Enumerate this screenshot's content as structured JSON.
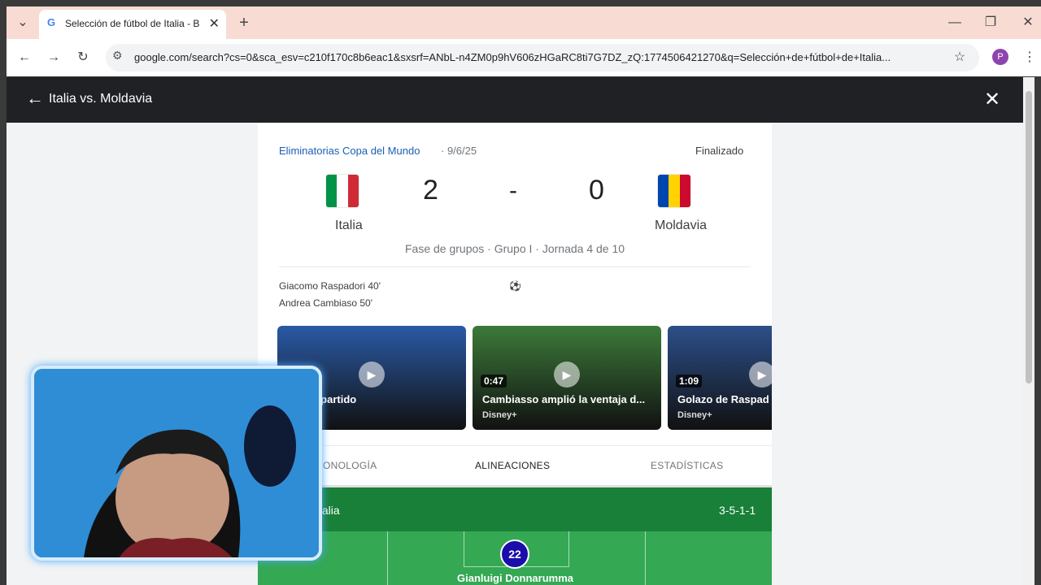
{
  "browser": {
    "tab_title": "Selección de fútbol de Italia - B",
    "favicon": "G",
    "tab_close": "✕",
    "new_tab": "+",
    "tab_menu": "⌄",
    "url": "google.com/search?cs=0&sca_esv=c210f170c8b6eac1&sxsrf=ANbL-n4ZM0p9hV606zHGaRC8ti7G7DZ_zQ:1774506421270&q=Selección+de+fútbol+de+Italia...",
    "profile_initial": "P",
    "window_minimize": "—",
    "window_restore": "❐",
    "window_close": "✕",
    "back": "←",
    "forward": "→",
    "reload": "↻",
    "site_info": "⚙",
    "bookmark": "☆",
    "menu": "⋮"
  },
  "header": {
    "back_icon": "←",
    "title": "Italia vs. Moldavia",
    "close_icon": "✕"
  },
  "match": {
    "competition": "Eliminatorias Copa del Mundo",
    "date": "· 9/6/25",
    "status": "Finalizado",
    "home": {
      "name": "Italia",
      "score": "2",
      "flag_colors": [
        "#009246",
        "#ffffff",
        "#ce2b37"
      ]
    },
    "separator": "-",
    "away": {
      "name": "Moldavia",
      "score": "0",
      "flag_colors": [
        "#0046ae",
        "#ffd200",
        "#cc092f"
      ]
    },
    "stage": "Fase de grupos · Grupo I · Jornada 4 de 10",
    "scorers": [
      "Giacomo Raspadori 40'",
      "Andrea Cambiaso 50'"
    ],
    "ball_icon": "⚽"
  },
  "videos": [
    {
      "title": "en del partido",
      "duration": "",
      "source": "",
      "bg": "#2a5aa6"
    },
    {
      "title": "Cambiasso amplió la ventaja d...",
      "duration": "0:47",
      "source": "Disney+",
      "bg": "#3c7a3a"
    },
    {
      "title": "Golazo de Raspad",
      "duration": "1:09",
      "source": "Disney+",
      "bg": "#2c4f8a"
    }
  ],
  "tabs": [
    {
      "label": "ONOLOGÍA"
    },
    {
      "label": "ALINEACIONES"
    },
    {
      "label": "ESTADÍSTICAS"
    }
  ],
  "lineup": {
    "team": "talia",
    "formation": "3-5-1-1",
    "keeper_number": "22",
    "keeper_name": "Gianluigi Donnarumma"
  },
  "colors": {
    "lineup_green": "#188038",
    "pitch_green": "#34a853",
    "header_dark": "#202124",
    "webcam_border": "#d8ecff"
  }
}
